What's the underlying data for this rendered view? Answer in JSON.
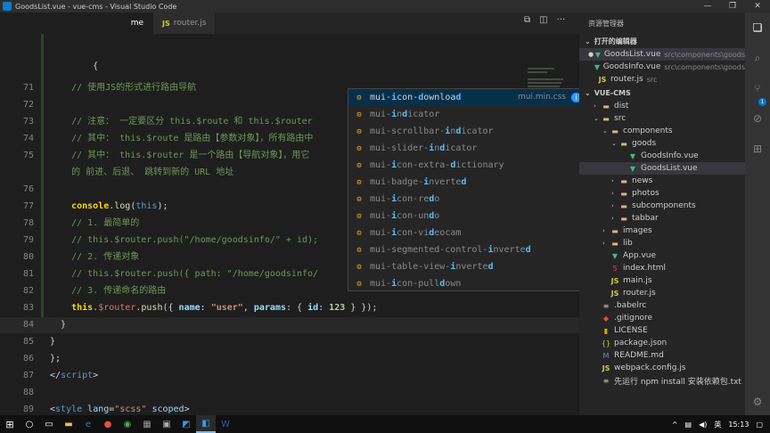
{
  "window": {
    "title": "GoodsList.vue - vue-cms - Visual Studio Code",
    "minimize": "—",
    "restore": "❐",
    "close": "✕"
  },
  "tabs": [
    {
      "label": "me"
    },
    {
      "label": "router.js"
    }
  ],
  "editor": {
    "lines": [
      {
        "n": "",
        "segments": [
          {
            "t": "        {",
            "c": "c-plain"
          }
        ]
      },
      {
        "n": "71",
        "segments": [
          {
            "t": "    // 使用JS的形式进行路由导航",
            "c": "c-comment"
          }
        ]
      },
      {
        "n": "72",
        "segments": [
          {
            "t": "",
            "c": "c-plain"
          }
        ]
      },
      {
        "n": "73",
        "segments": [
          {
            "t": "    // 注意： 一定要区分 this.$route 和 this.$router",
            "c": "c-comment"
          }
        ]
      },
      {
        "n": "74",
        "segments": [
          {
            "t": "    // 其中： this.$route 是路由【参数对象】，所有路由中",
            "c": "c-comment"
          }
        ]
      },
      {
        "n": "75",
        "segments": [
          {
            "t": "    // 其中： this.$router 是一个路由【导航对象】，用它",
            "c": "c-comment"
          }
        ]
      },
      {
        "n": "",
        "segments": [
          {
            "t": "    的 前进、后退、 跳转到新的 URL 地址",
            "c": "c-comment"
          }
        ]
      },
      {
        "n": "76",
        "segments": [
          {
            "t": "",
            "c": "c-plain"
          }
        ]
      },
      {
        "n": "77",
        "segments": [
          {
            "t": "    console",
            "c": "c-yellow c-bold"
          },
          {
            "t": ".",
            "c": "c-plain"
          },
          {
            "t": "log",
            "c": "c-fn"
          },
          {
            "t": "(",
            "c": "c-plain"
          },
          {
            "t": "this",
            "c": "c-keyword"
          },
          {
            "t": ");",
            "c": "c-plain"
          }
        ]
      },
      {
        "n": "78",
        "segments": [
          {
            "t": "    // 1. 最简单的",
            "c": "c-comment"
          }
        ]
      },
      {
        "n": "79",
        "segments": [
          {
            "t": "    // this.$router.push(\"/home/goodsinfo/\" + id);",
            "c": "c-comment"
          }
        ]
      },
      {
        "n": "80",
        "segments": [
          {
            "t": "    // 2. 传递对象",
            "c": "c-comment"
          }
        ]
      },
      {
        "n": "81",
        "segments": [
          {
            "t": "    // this.$router.push({ path: \"/home/goodsinfo/",
            "c": "c-comment"
          }
        ]
      },
      {
        "n": "82",
        "segments": [
          {
            "t": "    // 3. 传递命名的路由",
            "c": "c-comment"
          }
        ]
      },
      {
        "n": "83",
        "segments": [
          {
            "t": "    this",
            "c": "c-yellow c-bold"
          },
          {
            "t": ".",
            "c": "c-plain"
          },
          {
            "t": "$router",
            "c": "c-var"
          },
          {
            "t": ".",
            "c": "c-plain"
          },
          {
            "t": "push",
            "c": "c-fn"
          },
          {
            "t": "({ ",
            "c": "c-plain"
          },
          {
            "t": "name",
            "c": "c-attr c-bold"
          },
          {
            "t": ": ",
            "c": "c-plain"
          },
          {
            "t": "\"user\"",
            "c": "c-str c-bold"
          },
          {
            "t": ", ",
            "c": "c-plain"
          },
          {
            "t": "params",
            "c": "c-attr c-bold"
          },
          {
            "t": ": { ",
            "c": "c-plain"
          },
          {
            "t": "id",
            "c": "c-attr c-bold"
          },
          {
            "t": ": ",
            "c": "c-plain"
          },
          {
            "t": "123",
            "c": "c-num c-bold"
          },
          {
            "t": " } });",
            "c": "c-plain"
          }
        ]
      },
      {
        "n": "84",
        "segments": [
          {
            "t": "  }",
            "c": "c-plain"
          }
        ]
      },
      {
        "n": "85",
        "segments": [
          {
            "t": "}",
            "c": "c-plain"
          }
        ]
      },
      {
        "n": "86",
        "segments": [
          {
            "t": "};",
            "c": "c-plain"
          }
        ]
      },
      {
        "n": "87",
        "segments": [
          {
            "t": "</",
            "c": "c-plain"
          },
          {
            "t": "script",
            "c": "c-tag"
          },
          {
            "t": ">",
            "c": "c-plain"
          }
        ]
      },
      {
        "n": "88",
        "segments": [
          {
            "t": "",
            "c": "c-plain"
          }
        ]
      },
      {
        "n": "89",
        "segments": [
          {
            "t": "<",
            "c": "c-plain"
          },
          {
            "t": "style",
            "c": "c-tag"
          },
          {
            "t": " ",
            "c": "c-plain"
          },
          {
            "t": "lang",
            "c": "c-attr"
          },
          {
            "t": "=",
            "c": "c-plain"
          },
          {
            "t": "\"scss\"",
            "c": "c-str"
          },
          {
            "t": " ",
            "c": "c-plain"
          },
          {
            "t": "scoped",
            "c": "c-attr"
          },
          {
            "t": ">",
            "c": "c-plain"
          }
        ]
      }
    ]
  },
  "suggest": {
    "detail": "mui.min.css",
    "info": "i",
    "items": [
      {
        "parts": [
          [
            "mui-",
            0
          ],
          [
            "i",
            1
          ],
          [
            "con-",
            0
          ],
          [
            "d",
            1
          ],
          [
            "ownloa",
            0
          ],
          [
            "d",
            1
          ]
        ]
      },
      {
        "parts": [
          [
            "mui-",
            0
          ],
          [
            "i",
            1
          ],
          [
            "n",
            0
          ],
          [
            "d",
            1
          ],
          [
            "icator",
            0
          ]
        ]
      },
      {
        "parts": [
          [
            "mui-scrollbar-",
            0
          ],
          [
            "i",
            1
          ],
          [
            "n",
            0
          ],
          [
            "d",
            1
          ],
          [
            "icator",
            0
          ]
        ]
      },
      {
        "parts": [
          [
            "mui-slider-",
            0
          ],
          [
            "i",
            1
          ],
          [
            "n",
            0
          ],
          [
            "d",
            1
          ],
          [
            "icator",
            0
          ]
        ]
      },
      {
        "parts": [
          [
            "mui-",
            0
          ],
          [
            "i",
            1
          ],
          [
            "con-extra-",
            0
          ],
          [
            "d",
            1
          ],
          [
            "ictionary",
            0
          ]
        ]
      },
      {
        "parts": [
          [
            "mui-badge-",
            0
          ],
          [
            "i",
            1
          ],
          [
            "nverte",
            0
          ],
          [
            "d",
            1
          ]
        ]
      },
      {
        "parts": [
          [
            "mui-",
            0
          ],
          [
            "i",
            1
          ],
          [
            "con-re",
            0
          ],
          [
            "d",
            1
          ],
          [
            "o",
            0
          ]
        ]
      },
      {
        "parts": [
          [
            "mui-",
            0
          ],
          [
            "i",
            1
          ],
          [
            "con-un",
            0
          ],
          [
            "d",
            1
          ],
          [
            "o",
            0
          ]
        ]
      },
      {
        "parts": [
          [
            "mui-",
            0
          ],
          [
            "i",
            1
          ],
          [
            "con-vi",
            0
          ],
          [
            "d",
            1
          ],
          [
            "eocam",
            0
          ]
        ]
      },
      {
        "parts": [
          [
            "mui-segmented-control-",
            0
          ],
          [
            "i",
            1
          ],
          [
            "nverte",
            0
          ],
          [
            "d",
            1
          ]
        ]
      },
      {
        "parts": [
          [
            "mui-table-view-",
            0
          ],
          [
            "i",
            1
          ],
          [
            "nverte",
            0
          ],
          [
            "d",
            1
          ]
        ]
      },
      {
        "parts": [
          [
            "mui-",
            0
          ],
          [
            "i",
            1
          ],
          [
            "con-pull",
            0
          ],
          [
            "d",
            1
          ],
          [
            "own",
            0
          ]
        ]
      }
    ]
  },
  "explorer": {
    "title": "资源管理器",
    "open_editors_label": "打开的编辑器",
    "open_editors": [
      {
        "name": "GoodsList.vue",
        "path": "src\\components\\goods",
        "icon": "vue",
        "selected": true,
        "dot": "●"
      },
      {
        "name": "GoodsInfo.vue",
        "path": "src\\components\\goods",
        "icon": "vue"
      },
      {
        "name": "router.js",
        "path": "src",
        "icon": "js"
      }
    ],
    "project_label": "VUE-CMS",
    "tree": [
      {
        "name": "dist",
        "depth": 0,
        "arrow": "›",
        "icon": "folder"
      },
      {
        "name": "src",
        "depth": 0,
        "arrow": "⌄",
        "icon": "folder"
      },
      {
        "name": "components",
        "depth": 1,
        "arrow": "⌄",
        "icon": "folder"
      },
      {
        "name": "goods",
        "depth": 2,
        "arrow": "⌄",
        "icon": "folder"
      },
      {
        "name": "GoodsInfo.vue",
        "depth": 3,
        "arrow": "",
        "icon": "vue"
      },
      {
        "name": "GoodsList.vue",
        "depth": 3,
        "arrow": "",
        "icon": "vue",
        "selected": true
      },
      {
        "name": "news",
        "depth": 2,
        "arrow": "›",
        "icon": "folder"
      },
      {
        "name": "photos",
        "depth": 2,
        "arrow": "›",
        "icon": "folder"
      },
      {
        "name": "subcomponents",
        "depth": 2,
        "arrow": "›",
        "icon": "folder"
      },
      {
        "name": "tabbar",
        "depth": 2,
        "arrow": "›",
        "icon": "folder"
      },
      {
        "name": "images",
        "depth": 1,
        "arrow": "›",
        "icon": "folder"
      },
      {
        "name": "lib",
        "depth": 1,
        "arrow": "›",
        "icon": "folder"
      },
      {
        "name": "App.vue",
        "depth": 1,
        "arrow": "",
        "icon": "vue"
      },
      {
        "name": "index.html",
        "depth": 1,
        "arrow": "",
        "icon": "html"
      },
      {
        "name": "main.js",
        "depth": 1,
        "arrow": "",
        "icon": "js"
      },
      {
        "name": "router.js",
        "depth": 1,
        "arrow": "",
        "icon": "js"
      },
      {
        "name": ".babelrc",
        "depth": 0,
        "arrow": "",
        "icon": "txt"
      },
      {
        "name": ".gitignore",
        "depth": 0,
        "arrow": "",
        "icon": "git"
      },
      {
        "name": "LICENSE",
        "depth": 0,
        "arrow": "",
        "icon": "lic"
      },
      {
        "name": "package.json",
        "depth": 0,
        "arrow": "",
        "icon": "json"
      },
      {
        "name": "README.md",
        "depth": 0,
        "arrow": "",
        "icon": "md"
      },
      {
        "name": "webpack.config.js",
        "depth": 0,
        "arrow": "",
        "icon": "js"
      },
      {
        "name": "先运行 npm install 安装依赖包.txt",
        "depth": 0,
        "arrow": "",
        "icon": "txt"
      }
    ]
  },
  "activity_bar": {
    "badge": "1"
  },
  "taskbar": {
    "lang": "英",
    "time": "15:13"
  }
}
